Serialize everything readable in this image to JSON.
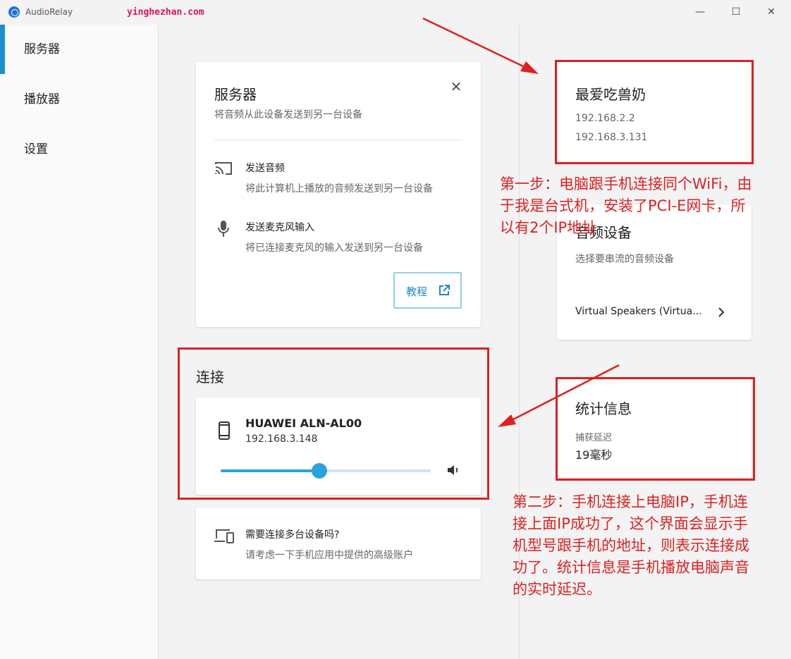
{
  "window": {
    "title": "AudioRelay",
    "watermark": "yinghezhan.com",
    "minimize_glyph": "—",
    "maximize_glyph": "☐",
    "close_glyph": "✕"
  },
  "sidebar": {
    "items": [
      {
        "label": "服务器",
        "active": true
      },
      {
        "label": "播放器",
        "active": false
      },
      {
        "label": "设置",
        "active": false
      }
    ]
  },
  "server_card": {
    "title": "服务器",
    "subtitle": "将音频从此设备发送到另一台设备",
    "close_glyph": "✕",
    "items": [
      {
        "icon": "cast-icon",
        "title": "发送音频",
        "desc": "将此计算机上播放的音频发送到另一台设备"
      },
      {
        "icon": "microphone-icon",
        "title": "发送麦克风输入",
        "desc": "将已连接麦克风的输入发送到另一台设备"
      }
    ],
    "tutorial_label": "教程"
  },
  "connection": {
    "title": "连接",
    "device_name": "HUAWEI ALN-AL00",
    "device_ip": "192.168.3.148",
    "volume_percent": 47
  },
  "multi_device": {
    "title": "需要连接多台设备吗?",
    "desc": "请考虑一下手机应用中提供的高级账户"
  },
  "host": {
    "name": "最爱吃兽奶",
    "ip1": "192.168.2.2",
    "ip2": "192.168.3.131"
  },
  "audio_device": {
    "title": "音频设备",
    "subtitle": "选择要串流的音频设备",
    "selected": "Virtual Speakers (Virtua..."
  },
  "stats": {
    "title": "统计信息",
    "latency_label": "捕获延迟",
    "latency_value": "19毫秒"
  },
  "annotations": {
    "step1": [
      "第一步：电脑跟手机连接同个WiFi，由",
      "于我是台式机，安装了PCI-E网卡，所",
      "以有2个IP地址"
    ],
    "step2": [
      "第二步：手机连接上电脑IP，手机连",
      "接上面IP成功了，这个界面会显示手",
      "机型号跟手机的地址，则表示连接成",
      "功了。统计信息是手机播放电脑声音",
      "的实时延迟。"
    ],
    "color": "#dd2222"
  },
  "colors": {
    "accent": "#29a3dd",
    "annotation_red": "#e0201f",
    "nav_indicator": "#1e8fcf"
  }
}
